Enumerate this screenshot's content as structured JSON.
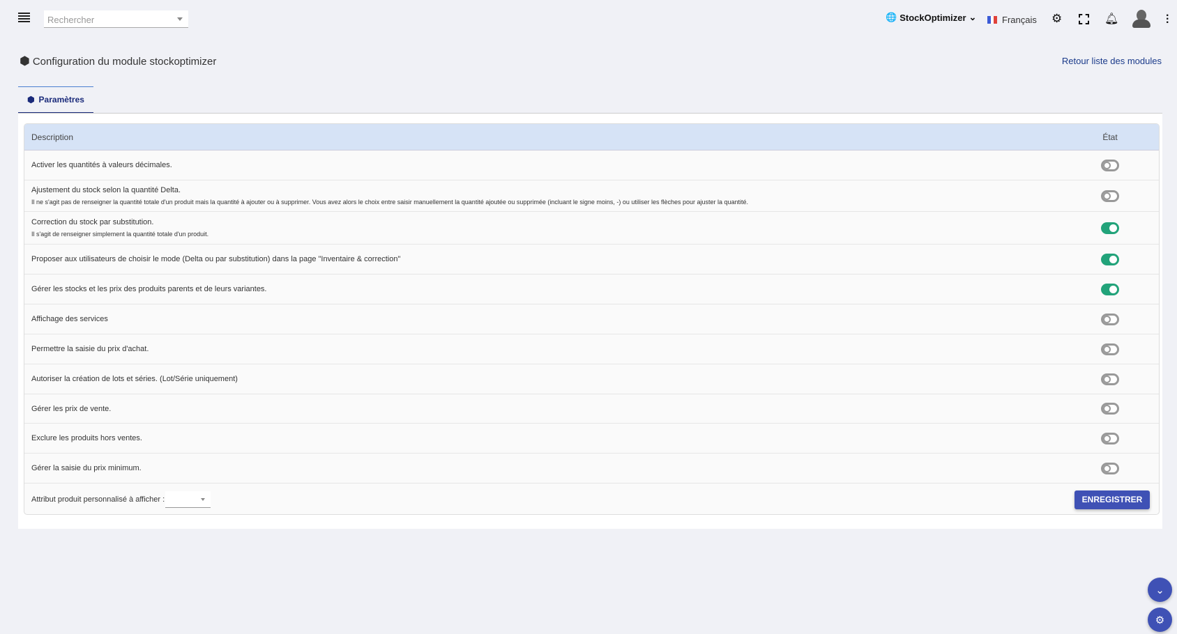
{
  "header": {
    "search_placeholder": "Rechercher",
    "brand": "StockOptimizer",
    "language": "Français"
  },
  "page": {
    "title": "Configuration du module stockoptimizer",
    "back_link": "Retour liste des modules",
    "tab": "Paramètres"
  },
  "table": {
    "col_description": "Description",
    "col_state": "État",
    "rows": [
      {
        "label": "Activer les quantités à valeurs décimales.",
        "sub": "",
        "on": false
      },
      {
        "label": "Ajustement du stock selon la quantité Delta.",
        "sub": "Il ne s'agit pas de renseigner la quantité totale d'un produit mais la quantité à ajouter ou à supprimer. Vous avez alors le choix entre saisir manuellement la quantité ajoutée ou supprimée (incluant le signe moins, -) ou utiliser les flèches pour ajuster la quantité.",
        "on": false
      },
      {
        "label": "Correction du stock par substitution.",
        "sub": "Il s'agit de renseigner simplement la quantité totale d'un produit.",
        "on": true
      },
      {
        "label": "Proposer aux utilisateurs de choisir le mode (Delta ou par substitution) dans la page \"Inventaire & correction\"",
        "sub": "",
        "on": true
      },
      {
        "label": "Gérer les stocks et les prix des produits parents et de leurs variantes.",
        "sub": "",
        "on": true
      },
      {
        "label": "Affichage des services",
        "sub": "",
        "on": false
      },
      {
        "label": "Permettre la saisie du prix d'achat.",
        "sub": "",
        "on": false
      },
      {
        "label": "Autoriser la création de lots et séries. (Lot/Série uniquement)",
        "sub": "",
        "on": false
      },
      {
        "label": "Gérer les prix de vente.",
        "sub": "",
        "on": false
      },
      {
        "label": "Exclure les produits hors ventes.",
        "sub": "",
        "on": false
      },
      {
        "label": "Gérer la saisie du prix minimum.",
        "sub": "",
        "on": false
      }
    ],
    "footer_label": "Attribut produit personnalisé à afficher :",
    "save": "ENREGISTRER"
  },
  "colors": {
    "accent": "#3f51b5",
    "toggle_on": "#22a37a",
    "header_bg": "#d6e3f6"
  }
}
